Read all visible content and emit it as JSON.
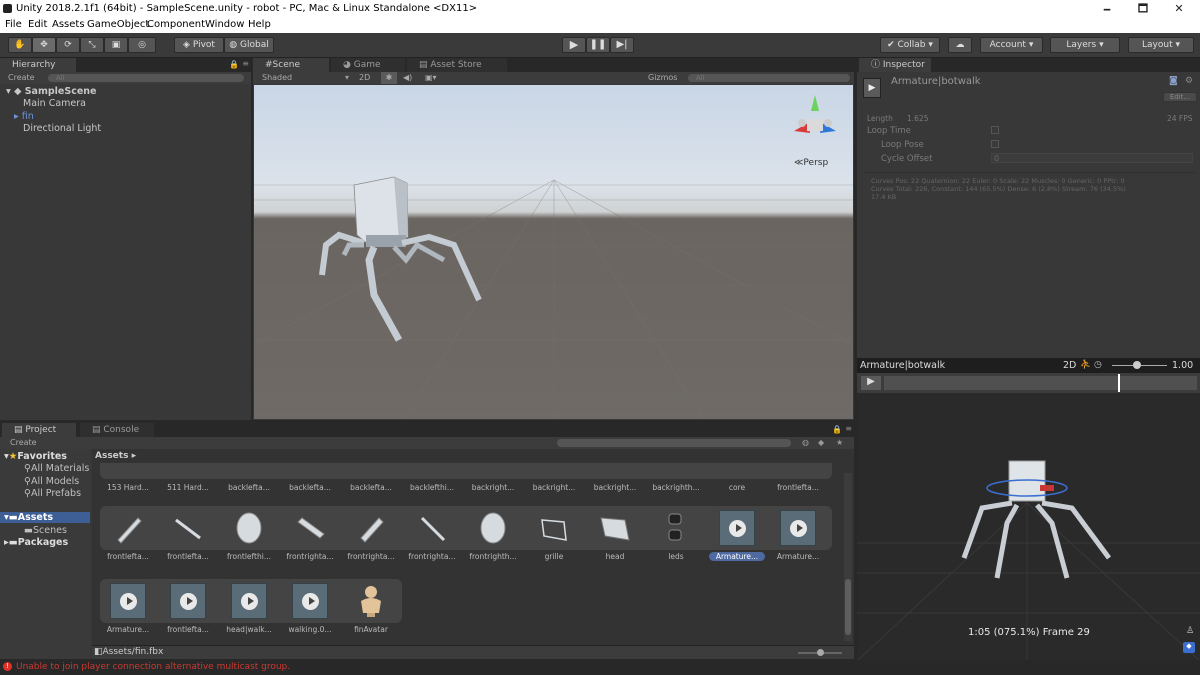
{
  "window": {
    "title": "Unity 2018.2.1f1 (64bit) - SampleScene.unity - robot - PC, Mac & Linux Standalone <DX11>",
    "minimize": "🗕",
    "maximize": "🗖",
    "close": "✕"
  },
  "menu": [
    "File",
    "Edit",
    "Assets",
    "GameObject",
    "Component",
    "Window",
    "Help"
  ],
  "toolbar": {
    "pivot": "Pivot",
    "global": "Global",
    "collab": "Collab",
    "account": "Account",
    "layers": "Layers",
    "layout": "Layout"
  },
  "hierarchy": {
    "tab": "Hierarchy",
    "create": "Create",
    "search_placeholder": "All",
    "scene": "SampleScene",
    "items": [
      "Main Camera",
      "fin",
      "Directional Light"
    ]
  },
  "scene_tabs": {
    "scene": "Scene",
    "game": "Game",
    "asset_store": "Asset Store",
    "shading": "Shaded",
    "mode_2d": "2D",
    "gizmos": "Gizmos",
    "gizmos_search": "All",
    "persp": "Persp"
  },
  "inspector": {
    "tab": "Inspector",
    "title": "Armature|botwalk",
    "edit_btn": "Edit...",
    "length_label": "Length",
    "length_value": "1.625",
    "fps": "24 FPS",
    "loop_time": "Loop Time",
    "loop_pose": "Loop Pose",
    "cycle_offset": "Cycle Offset",
    "cycle_value": "0",
    "stats_line1": "Curves Pos: 22 Quaternion: 22 Euler: 0 Scale: 22 Muscles: 0 Generic: 0 PPtr: 0",
    "stats_line2": "Curves Total: 226, Constant: 144 (65.5%) Dense: 6 (2.8%) Stream: 76 (34.5%)",
    "stats_line3": "17.4 KB"
  },
  "preview": {
    "name": "Armature|botwalk",
    "mode_2d": "2D",
    "speed": "1.00",
    "frame_readout": "1:05 (075.1%) Frame 29"
  },
  "project": {
    "tab": "Project",
    "console_tab": "Console",
    "create": "Create",
    "favorites": "Favorites",
    "fav_items": [
      "All Materials",
      "All Models",
      "All Prefabs"
    ],
    "assets": "Assets",
    "assets_children": [
      "Scenes"
    ],
    "packages": "Packages",
    "breadcrumb": "Assets",
    "path": "Assets/fin.fbx",
    "row1": [
      "153 Hard...",
      "511 Hard...",
      "backlefta...",
      "backlefta...",
      "backlefta...",
      "backlefthi...",
      "backright...",
      "backright...",
      "backright...",
      "backrighth...",
      "core",
      "frontlefta..."
    ],
    "row2": [
      "frontlefta...",
      "frontlefta...",
      "frontlefthi...",
      "frontrighta...",
      "frontrighta...",
      "frontrighta...",
      "frontrighth...",
      "grille",
      "head",
      "leds",
      "Armature...",
      "Armature..."
    ],
    "row3": [
      "Armature...",
      "frontlefta...",
      "head|walk...",
      "walking.0...",
      "finAvatar"
    ]
  },
  "status": {
    "error": "Unable to join player connection alternative multicast group."
  },
  "colors": {
    "error": "#e0302a",
    "selected": "#3e5f96",
    "play_active": "#ffffff"
  }
}
